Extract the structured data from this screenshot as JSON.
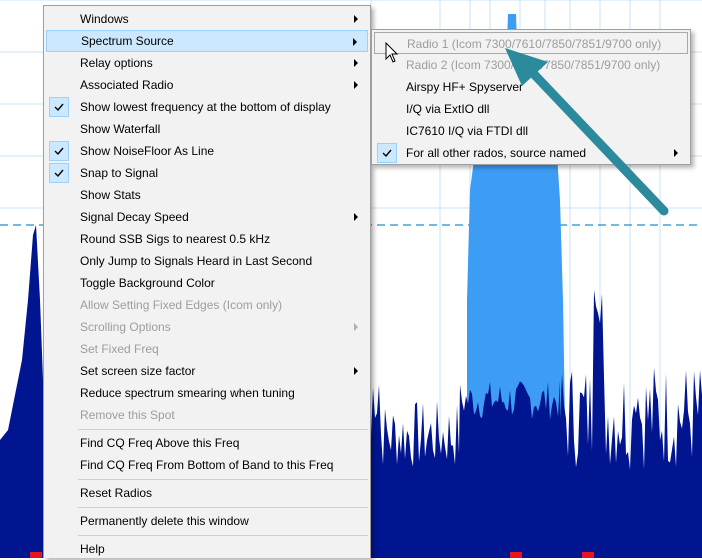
{
  "main_menu": {
    "items": [
      {
        "label": "Windows",
        "checked": false,
        "disabled": false,
        "submenu": true
      },
      {
        "label": "Spectrum Source",
        "checked": false,
        "disabled": false,
        "submenu": true,
        "highlighted": true
      },
      {
        "label": "Relay options",
        "checked": false,
        "disabled": false,
        "submenu": true
      },
      {
        "label": "Associated Radio",
        "checked": false,
        "disabled": false,
        "submenu": true
      },
      {
        "label": "Show lowest frequency at the bottom of display",
        "checked": true,
        "disabled": false,
        "submenu": false
      },
      {
        "label": "Show Waterfall",
        "checked": false,
        "disabled": false,
        "submenu": false
      },
      {
        "label": "Show NoiseFloor As Line",
        "checked": true,
        "disabled": false,
        "submenu": false
      },
      {
        "label": "Snap to Signal",
        "checked": true,
        "disabled": false,
        "submenu": false
      },
      {
        "label": "Show Stats",
        "checked": false,
        "disabled": false,
        "submenu": false
      },
      {
        "label": "Signal Decay Speed",
        "checked": false,
        "disabled": false,
        "submenu": true
      },
      {
        "label": "Round SSB Sigs to nearest 0.5 kHz",
        "checked": false,
        "disabled": false,
        "submenu": false
      },
      {
        "label": "Only Jump to Signals Heard in Last Second",
        "checked": false,
        "disabled": false,
        "submenu": false
      },
      {
        "label": "Toggle Background Color",
        "checked": false,
        "disabled": false,
        "submenu": false
      },
      {
        "label": "Allow Setting Fixed Edges (Icom only)",
        "checked": false,
        "disabled": true,
        "submenu": false
      },
      {
        "label": "Scrolling Options",
        "checked": false,
        "disabled": true,
        "submenu": true
      },
      {
        "label": "Set Fixed Freq",
        "checked": false,
        "disabled": true,
        "submenu": false
      },
      {
        "label": "Set screen size factor",
        "checked": false,
        "disabled": false,
        "submenu": true
      },
      {
        "label": "Reduce spectrum smearing when tuning",
        "checked": false,
        "disabled": false,
        "submenu": false
      },
      {
        "label": "Remove this Spot",
        "checked": false,
        "disabled": true,
        "submenu": false
      },
      {
        "label": "Find CQ Freq Above this Freq",
        "checked": false,
        "disabled": false,
        "submenu": false
      },
      {
        "label": "Find CQ Freq From Bottom of Band to this Freq",
        "checked": false,
        "disabled": false,
        "submenu": false
      },
      {
        "label": "Reset Radios",
        "checked": false,
        "disabled": false,
        "submenu": false
      },
      {
        "label": "Permanently delete this window",
        "checked": false,
        "disabled": false,
        "submenu": false
      },
      {
        "label": "Help",
        "checked": false,
        "disabled": false,
        "submenu": false
      }
    ]
  },
  "sub_menu": {
    "items": [
      {
        "label": "Radio 1 (Icom 7300/7610/7850/7851/9700 only)",
        "checked": false,
        "disabled": true,
        "submenu": false
      },
      {
        "label": "Radio 2 (Icom 7300/7610/7850/7851/9700 only)",
        "checked": false,
        "disabled": true,
        "submenu": false
      },
      {
        "label": "Airspy HF+ Spyserver",
        "checked": false,
        "disabled": false,
        "submenu": false
      },
      {
        "label": "I/Q via ExtIO dll",
        "checked": false,
        "disabled": false,
        "submenu": false
      },
      {
        "label": "IC7610 I/Q via FTDI dll",
        "checked": false,
        "disabled": false,
        "submenu": false
      },
      {
        "label": "For all other rados, source named",
        "checked": true,
        "disabled": false,
        "submenu": true
      }
    ]
  },
  "colors": {
    "spectrum_fill": "#00158f",
    "signal_fill": "#3d9df5",
    "grid_line": "#c9e2f5",
    "noise_floor_line": "#1e90c8",
    "menu_bg": "#f2f2f2",
    "highlight": "#cce8ff",
    "annotation_arrow": "#2b8a9c",
    "band_marker": "#e8141c"
  }
}
